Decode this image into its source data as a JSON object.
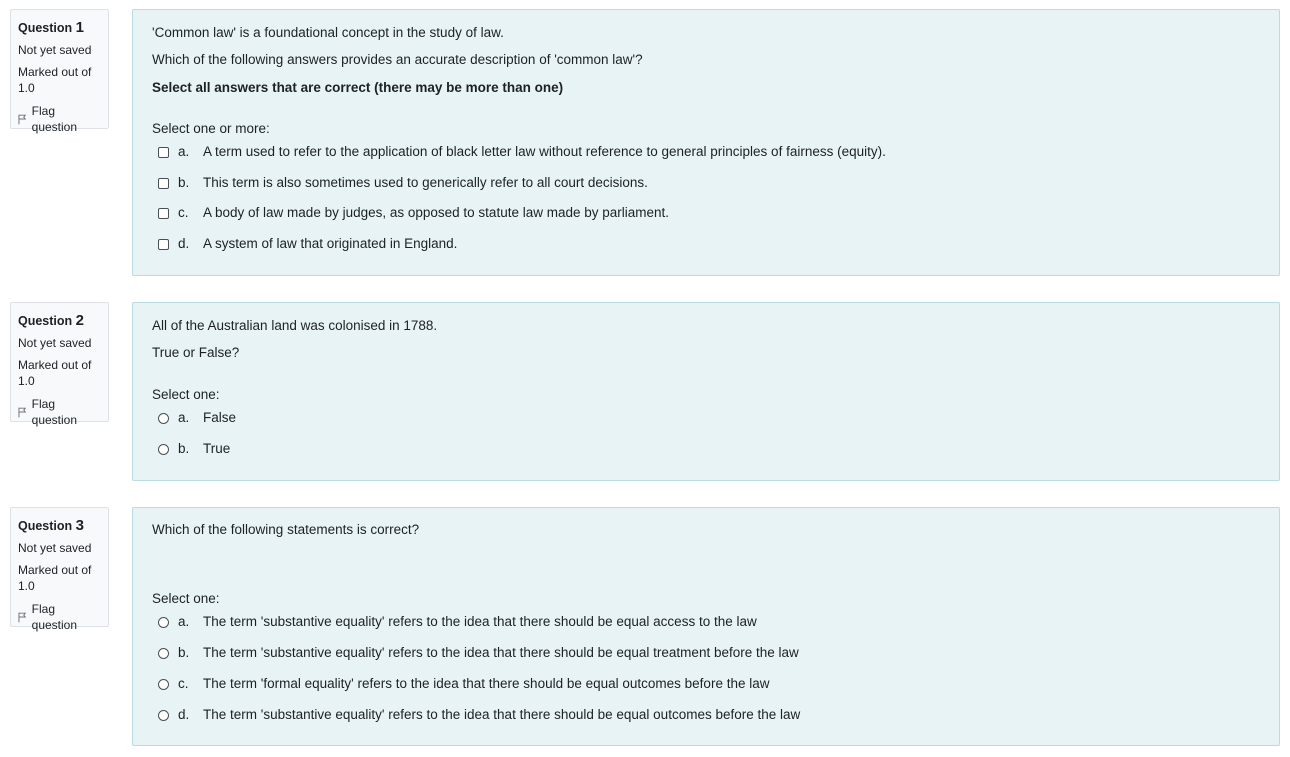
{
  "questions": [
    {
      "label": "Question",
      "number": "1",
      "state": "Not yet saved",
      "marked_line1": "Marked out of",
      "marked_line2": "1.0",
      "flag_label": "Flag question",
      "text_lines": [
        "'Common law' is a foundational concept in the study of law.",
        "Which of the following answers provides an accurate description of 'common law'?",
        "Select all answers that are correct (there may be more than one)"
      ],
      "prompt": "Select one or more:",
      "input_type": "checkbox",
      "options": [
        {
          "letter": "a.",
          "text": "A term used to refer to the application of black letter law without reference to general principles of fairness (equity)."
        },
        {
          "letter": "b.",
          "text": "This term is also sometimes used to generically refer to all court decisions."
        },
        {
          "letter": "c.",
          "text": "A body of law made by judges, as opposed to statute law made by parliament."
        },
        {
          "letter": "d.",
          "text": "A system of law that originated in England."
        }
      ]
    },
    {
      "label": "Question",
      "number": "2",
      "state": "Not yet saved",
      "marked_line1": "Marked out of",
      "marked_line2": "1.0",
      "flag_label": "Flag question",
      "text_lines": [
        "All of the Australian land was colonised in 1788.",
        "True or False?"
      ],
      "prompt": "Select one:",
      "input_type": "radio",
      "options": [
        {
          "letter": "a.",
          "text": "False"
        },
        {
          "letter": "b.",
          "text": "True"
        }
      ]
    },
    {
      "label": "Question",
      "number": "3",
      "state": "Not yet saved",
      "marked_line1": "Marked out of",
      "marked_line2": "1.0",
      "flag_label": "Flag question",
      "text_lines": [
        "Which of the following statements is correct?"
      ],
      "prompt": "Select one:",
      "input_type": "radio",
      "options": [
        {
          "letter": "a.",
          "text": "The term 'substantive equality' refers to the idea that there should be equal access to the law"
        },
        {
          "letter": "b.",
          "text": "The term 'substantive equality' refers to the idea that there should be equal treatment before the law"
        },
        {
          "letter": "c.",
          "text": "The term 'formal equality' refers to the idea that there should be equal outcomes before the law"
        },
        {
          "letter": "d.",
          "text": "The term 'substantive equality' refers to the idea that there should be equal outcomes before the law"
        }
      ]
    }
  ],
  "colors": {
    "info_bg": "#f8f9fa",
    "content_bg": "#e7f3f5",
    "content_border": "#b8dce2",
    "text": "#1d2125"
  }
}
